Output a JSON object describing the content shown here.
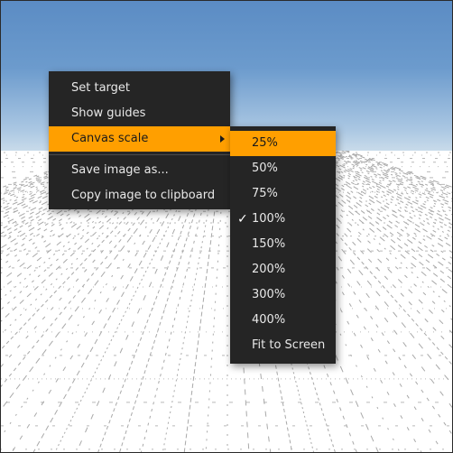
{
  "context_menu": {
    "items": [
      {
        "label": "Set target"
      },
      {
        "label": "Show guides"
      },
      {
        "label": "Canvas scale",
        "highlighted": true,
        "has_submenu": true
      },
      {
        "label": "Save image as..."
      },
      {
        "label": "Copy image to clipboard"
      }
    ]
  },
  "scale_submenu": {
    "items": [
      {
        "label": "25%",
        "highlighted": true
      },
      {
        "label": "50%"
      },
      {
        "label": "75%"
      },
      {
        "label": "100%",
        "checked": true,
        "check_glyph": "✓"
      },
      {
        "label": "150%"
      },
      {
        "label": "200%"
      },
      {
        "label": "300%"
      },
      {
        "label": "400%"
      },
      {
        "label": "Fit to Screen"
      }
    ]
  },
  "colors": {
    "menu_background": "#252525",
    "highlight": "#ff9f00",
    "sky_top": "#5b8cc4",
    "ground": "#ffffff"
  },
  "icons": {
    "submenu_arrow": "chevron-right-icon",
    "checkmark": "checkmark-icon"
  }
}
